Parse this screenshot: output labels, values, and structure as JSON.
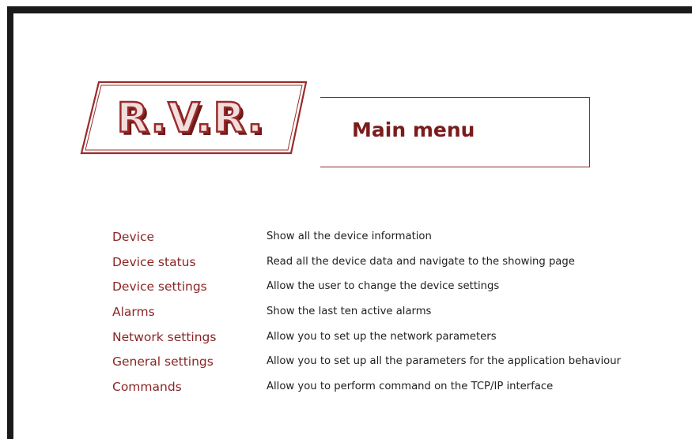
{
  "logo": {
    "text": "R.V.R.",
    "colors": {
      "primary": "#9a2b2b",
      "fill": "#f3dede",
      "shadow": "#6e1a1a"
    }
  },
  "header": {
    "title": "Main menu"
  },
  "menu": [
    {
      "label": "Device",
      "description": "Show all the device information"
    },
    {
      "label": "Device status",
      "description": "Read all the device data and navigate to the showing page"
    },
    {
      "label": "Device settings",
      "description": "Allow the user to change the device settings"
    },
    {
      "label": "Alarms",
      "description": "Show the last ten active alarms"
    },
    {
      "label": "Network settings",
      "description": "Allow you to set up the network parameters"
    },
    {
      "label": "General settings",
      "description": "Allow you to set up all the parameters for the application behaviour"
    },
    {
      "label": "Commands",
      "description": "Allow you to perform command on the TCP/IP interface"
    }
  ],
  "colors": {
    "accent": "#8a2525",
    "text": "#1f1f1f",
    "frame": "#1a1a1a"
  }
}
